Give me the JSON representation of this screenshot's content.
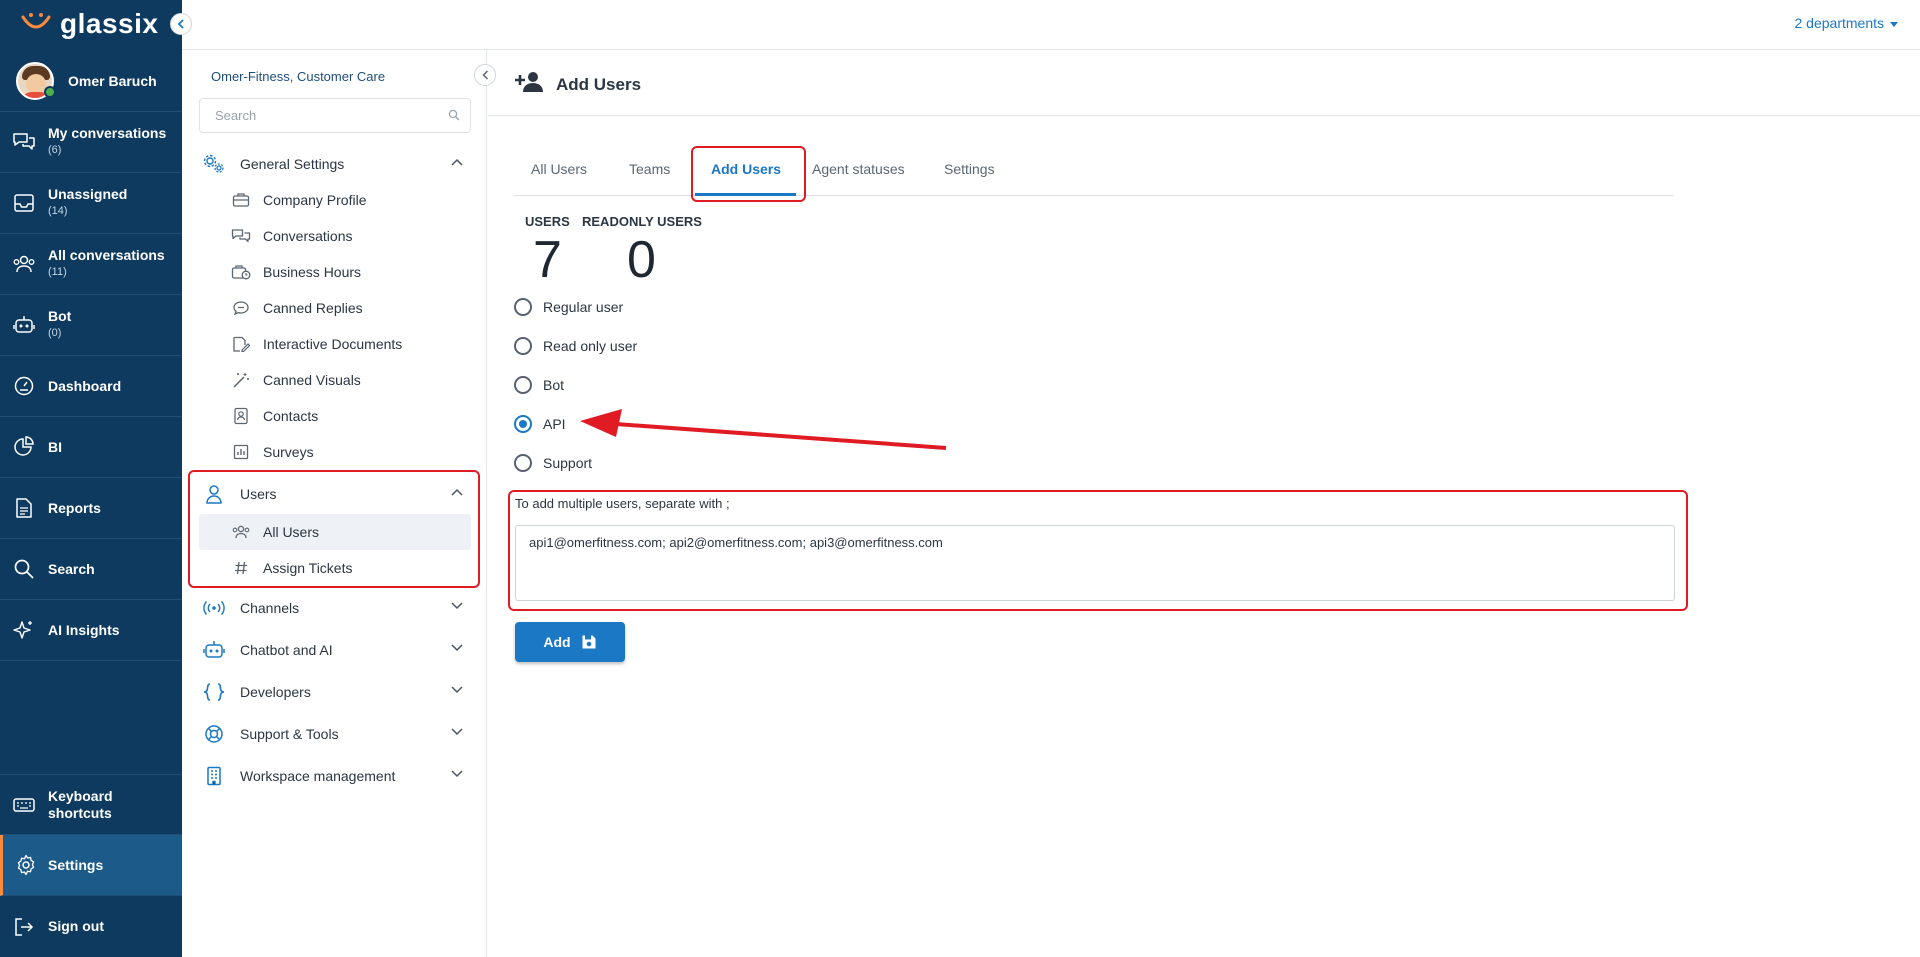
{
  "brand": {
    "name": "glassix"
  },
  "topbar": {
    "departments": "2 departments"
  },
  "profile": {
    "name": "Omer Baruch"
  },
  "nav": [
    {
      "label": "My conversations",
      "count": "(6)",
      "icon": "chat-bubbles-icon"
    },
    {
      "label": "Unassigned",
      "count": "(14)",
      "icon": "inbox-icon"
    },
    {
      "label": "All conversations",
      "count": "(11)",
      "icon": "people-icon"
    },
    {
      "label": "Bot",
      "count": "(0)",
      "icon": "robot-icon"
    },
    {
      "label": "Dashboard",
      "count": "",
      "icon": "gauge-icon"
    },
    {
      "label": "BI",
      "count": "",
      "icon": "pie-chart-icon"
    },
    {
      "label": "Reports",
      "count": "",
      "icon": "document-icon"
    },
    {
      "label": "Search",
      "count": "",
      "icon": "search-icon"
    },
    {
      "label": "AI Insights",
      "count": "",
      "icon": "sparkle-icon"
    }
  ],
  "nav_bottom": {
    "keyboard": "Keyboard shortcuts",
    "settings": "Settings",
    "signout": "Sign out"
  },
  "sub": {
    "org": "Omer-Fitness, Customer Care",
    "search_placeholder": "Search",
    "general_settings": "General Settings",
    "general_items": [
      "Company Profile",
      "Conversations",
      "Business Hours",
      "Canned Replies",
      "Interactive Documents",
      "Canned Visuals",
      "Contacts",
      "Surveys"
    ],
    "users": "Users",
    "users_items": [
      "All Users",
      "Assign Tickets"
    ],
    "groups": [
      "Channels",
      "Chatbot and AI",
      "Developers",
      "Support & Tools",
      "Workspace management"
    ]
  },
  "page": {
    "title": "Add Users",
    "tabs": [
      "All Users",
      "Teams",
      "Add Users",
      "Agent statuses",
      "Settings"
    ],
    "active_tab": "Add Users",
    "stats": {
      "users_label": "USERS",
      "users_value": "7",
      "readonly_label": "READONLY USERS",
      "readonly_value": "0"
    },
    "user_types": [
      "Regular user",
      "Read only user",
      "Bot",
      "API",
      "Support"
    ],
    "selected_type": "API",
    "hint": "To add multiple users, separate with ;",
    "emails": "api1@omerfitness.com; api2@omerfitness.com; api3@omerfitness.com",
    "add_button": "Add"
  },
  "colors": {
    "nav_bg": "#0d3a5e",
    "accent": "#1b78c4",
    "highlight": "#e01b24",
    "active_marker": "#ff8a3d"
  }
}
